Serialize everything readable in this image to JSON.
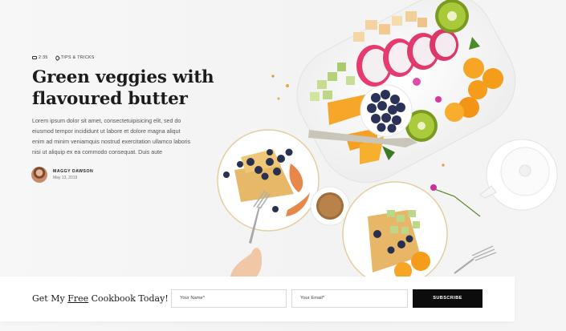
{
  "post": {
    "duration": "2:35",
    "category": "TIPS & TRICKS",
    "title": "Green veggies with flavoured butter",
    "excerpt": "Lorem ipsum dolor sit amet, consectetuipisicing elit, sed do eiusmod tempor incididunt ut labore et dolore magna aliqut enim ad minim veniamquis nostrud exercitation ullamco laboris nisi ut aliquip ex ea commodo consequat. Duis aute",
    "author": "MAGGY DAWSON",
    "date": "May 13, 2019"
  },
  "signup": {
    "label_pre": "Get My ",
    "label_link": "Free",
    "label_post": " Cookbook Today!",
    "name_placeholder": "Your Name*",
    "email_placeholder": "Your Email*",
    "button": "SUBSCRIBE"
  },
  "colors": {
    "background": "#f6f6f6",
    "button_bg": "#0c0c0c",
    "title": "#1c1c1c"
  }
}
